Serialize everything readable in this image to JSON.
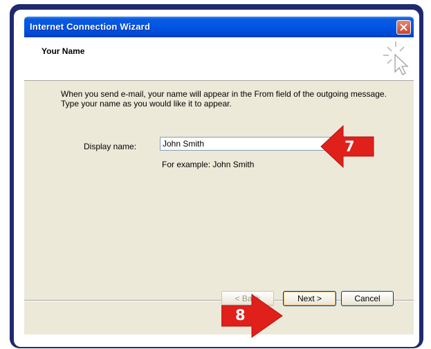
{
  "window": {
    "title": "Internet Connection Wizard"
  },
  "header": {
    "title": "Your Name"
  },
  "body": {
    "description_line1": "When you send e-mail, your name will appear in the From field of the outgoing message.",
    "description_line2": "Type your name as you would like it to appear.",
    "display_name_label": "Display name:",
    "display_name_value": "John Smith",
    "example_text": "For example: John Smith"
  },
  "buttons": {
    "back_label": "< Back",
    "next_label": "Next >",
    "cancel_label": "Cancel"
  },
  "callouts": {
    "step_7": "7",
    "step_8": "8"
  },
  "colors": {
    "frame": "#1f2a6e",
    "titlebar": "#0055e5",
    "callout_red": "#e0201b",
    "dialog_bg": "#ece9d8"
  },
  "icons": [
    "close-icon",
    "wizard-cursor-icon",
    "arrow-callout-icon"
  ]
}
